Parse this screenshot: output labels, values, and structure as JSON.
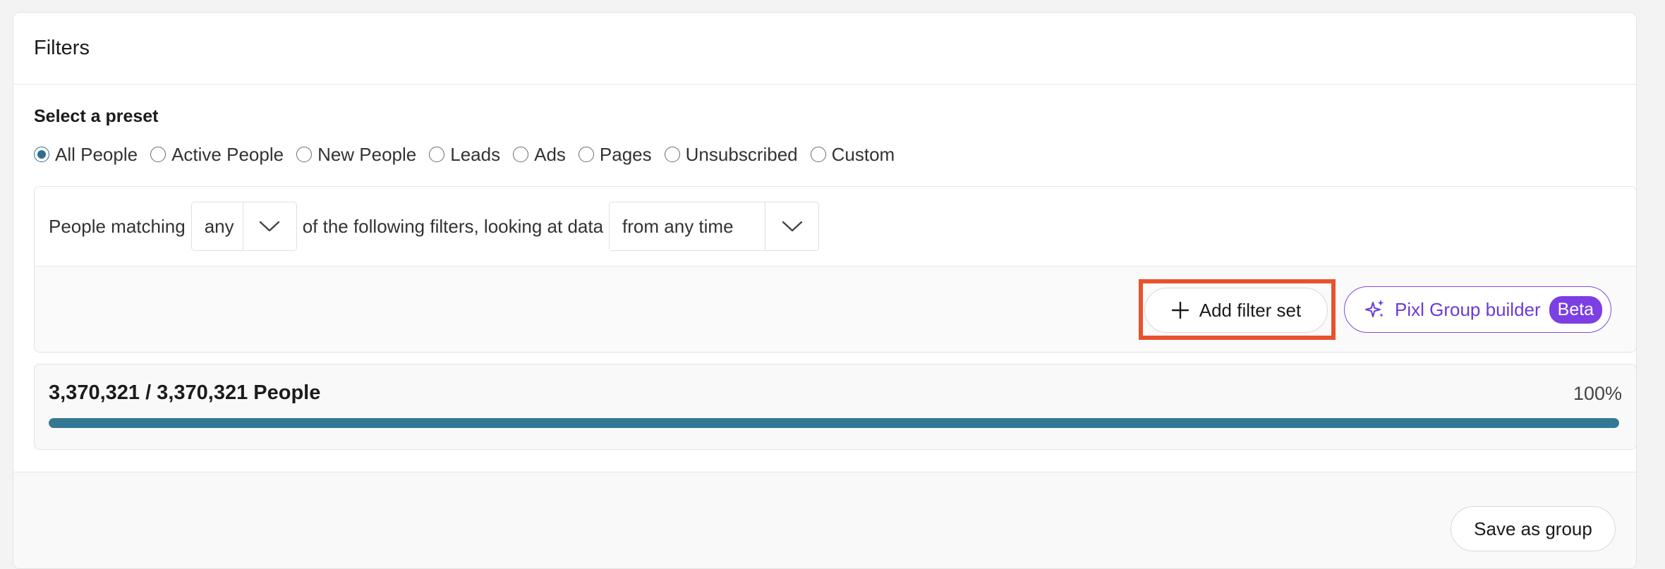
{
  "panel": {
    "title": "Filters"
  },
  "preset": {
    "title": "Select a preset",
    "options": [
      {
        "label": "All People",
        "checked": true
      },
      {
        "label": "Active People",
        "checked": false
      },
      {
        "label": "New People",
        "checked": false
      },
      {
        "label": "Leads",
        "checked": false
      },
      {
        "label": "Ads",
        "checked": false
      },
      {
        "label": "Pages",
        "checked": false
      },
      {
        "label": "Unsubscribed",
        "checked": false
      },
      {
        "label": "Custom",
        "checked": false
      }
    ]
  },
  "filter": {
    "prefix": "People matching",
    "match_value": "any",
    "middle": "of the following filters, looking at data",
    "time_value": "from any time"
  },
  "actions": {
    "add_filter_set": "Add filter set",
    "pixl_builder": "Pixl Group builder",
    "beta_badge": "Beta"
  },
  "summary": {
    "count_text": "3,370,321 / 3,370,321 People",
    "percent_text": "100%",
    "progress_fraction": 1.0
  },
  "footer": {
    "save_as_group": "Save as group"
  },
  "colors": {
    "accent": "#347792",
    "purple": "#7b3fe4",
    "highlight": "#e8532d"
  }
}
